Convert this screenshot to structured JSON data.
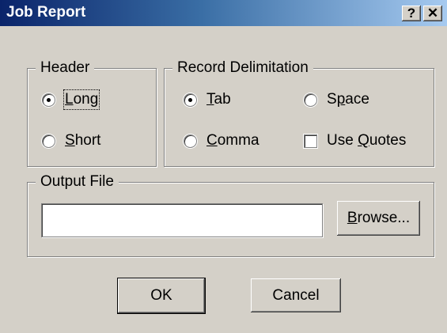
{
  "window": {
    "title": "Job Report"
  },
  "header_group": {
    "legend": "Header",
    "options": [
      {
        "label": "Long",
        "accel": "L",
        "rest": "ong",
        "checked": true
      },
      {
        "label": "Short",
        "accel": "S",
        "rest": "hort",
        "checked": false
      }
    ]
  },
  "delim_group": {
    "legend": "Record Delimitation",
    "tab": {
      "accel": "T",
      "rest": "ab",
      "checked": true
    },
    "space": {
      "pre": "S",
      "accel": "p",
      "rest": "ace",
      "checked": false
    },
    "comma": {
      "accel": "C",
      "rest": "omma",
      "checked": false
    },
    "use_quotes": {
      "pre": "Use ",
      "accel": "Q",
      "rest": "uotes",
      "checked": false
    }
  },
  "output_group": {
    "legend": "Output File",
    "value": "",
    "browse": {
      "accel": "B",
      "rest": "rowse..."
    }
  },
  "buttons": {
    "ok": "OK",
    "cancel": "Cancel"
  }
}
